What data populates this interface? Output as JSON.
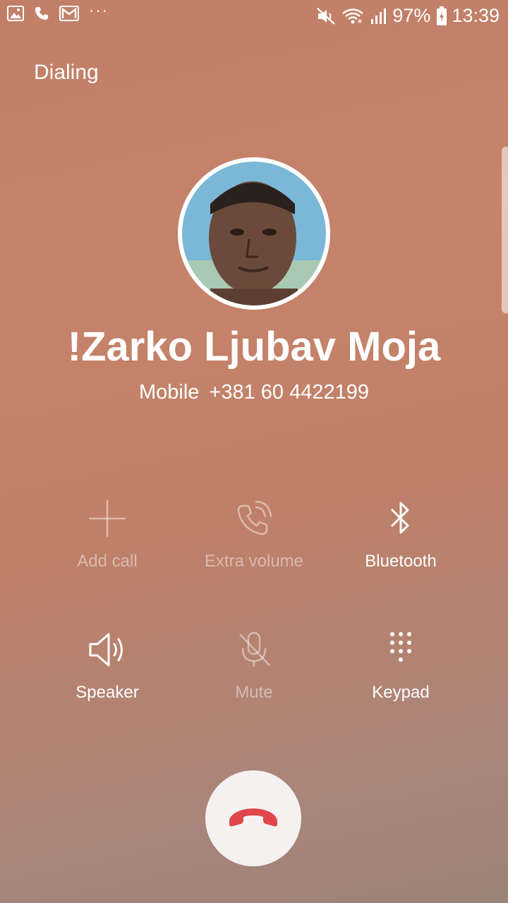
{
  "status_bar": {
    "icons_left": [
      "gallery-icon",
      "phone-icon",
      "gmail-icon",
      "more-notifications-icon"
    ],
    "more_label": "···",
    "icons_right": [
      "mute-icon",
      "wifi-icon",
      "signal-icon",
      "battery-charging-icon"
    ],
    "battery": "97%",
    "time": "13:39"
  },
  "call": {
    "state": "Dialing",
    "contact_name": "!Zarko Ljubav Moja",
    "number_type": "Mobile",
    "number": "+381 60 4422199"
  },
  "controls": [
    {
      "label": "Add call",
      "icon": "add-icon",
      "enabled": false
    },
    {
      "label": "Extra volume",
      "icon": "extra-volume-icon",
      "enabled": false
    },
    {
      "label": "Bluetooth",
      "icon": "bluetooth-icon",
      "enabled": true
    },
    {
      "label": "Speaker",
      "icon": "speaker-icon",
      "enabled": true
    },
    {
      "label": "Mute",
      "icon": "mute-mic-icon",
      "enabled": false
    },
    {
      "label": "Keypad",
      "icon": "keypad-icon",
      "enabled": true
    }
  ],
  "end_call": {
    "icon": "end-call-icon"
  },
  "colors": {
    "background": "#c27f68",
    "end_call_icon": "#e0464a",
    "end_call_button": "#f4f1f0"
  }
}
